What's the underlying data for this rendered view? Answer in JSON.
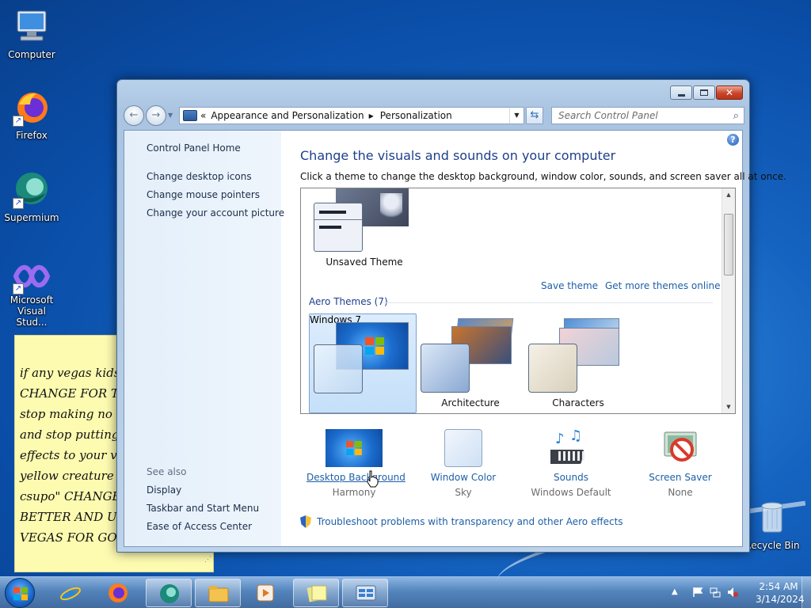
{
  "desktop": {
    "icons": [
      {
        "label": "Computer"
      },
      {
        "label": "Firefox"
      },
      {
        "label": "Supermium"
      },
      {
        "label": "Microsoft Visual Stud..."
      },
      {
        "label": "Recycle Bin"
      }
    ]
  },
  "sticky_note": {
    "lines": [
      "if any vegas kids",
      "CHANGE FOR T",
      "stop making no",
      "and stop putting",
      "effects to your v",
      "yellow creature",
      "csupo\" CHANGE",
      "BETTER AND U",
      "VEGAS FOR GO"
    ]
  },
  "window": {
    "address": {
      "overflow": "«",
      "crumbs": [
        "Appearance and Personalization",
        "Personalization"
      ]
    },
    "search_placeholder": "Search Control Panel",
    "left_pane": {
      "home": "Control Panel Home",
      "links": [
        "Change desktop icons",
        "Change mouse pointers",
        "Change your account picture"
      ],
      "see_also_label": "See also",
      "see_also": [
        "Display",
        "Taskbar and Start Menu",
        "Ease of Access Center"
      ]
    },
    "main": {
      "title": "Change the visuals and sounds on your computer",
      "subtitle": "Click a theme to change the desktop background, window color, sounds, and screen saver all at once.",
      "unsaved_theme": "Unsaved Theme",
      "save_theme": "Save theme",
      "get_more": "Get more themes online",
      "aero_header": "Aero Themes (7)",
      "aero_themes": [
        "Windows 7",
        "Architecture",
        "Characters"
      ],
      "selected_theme": "Windows 7"
    },
    "bottom": [
      {
        "name": "Desktop Background",
        "value": "Harmony"
      },
      {
        "name": "Window Color",
        "value": "Sky"
      },
      {
        "name": "Sounds",
        "value": "Windows Default"
      },
      {
        "name": "Screen Saver",
        "value": "None"
      }
    ],
    "troubleshoot": "Troubleshoot problems with transparency and other Aero effects"
  },
  "taskbar": {
    "clock_time": "2:54 AM",
    "clock_date": "3/14/2024"
  },
  "colors": {
    "link": "#1d5fa8",
    "title": "#1e3f8c",
    "selection": "#c5e0fa"
  }
}
